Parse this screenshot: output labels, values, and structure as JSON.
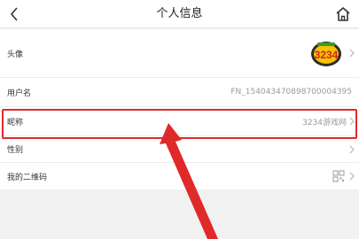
{
  "header": {
    "title": "个人信息",
    "back_icon": "chevron-left-icon",
    "home_icon": "home-icon"
  },
  "rows": {
    "avatar": {
      "label": "头像",
      "image_text": "3234"
    },
    "username": {
      "label": "用户名",
      "value": "FN_1540434708987000043​95"
    },
    "nickname": {
      "label": "昵称",
      "value": "3234游戏网"
    },
    "gender": {
      "label": "性别",
      "value": ""
    },
    "qr": {
      "label": "我的二维码"
    }
  },
  "colors": {
    "highlight": "#e02a2a",
    "arrow": "#e02a2a"
  }
}
